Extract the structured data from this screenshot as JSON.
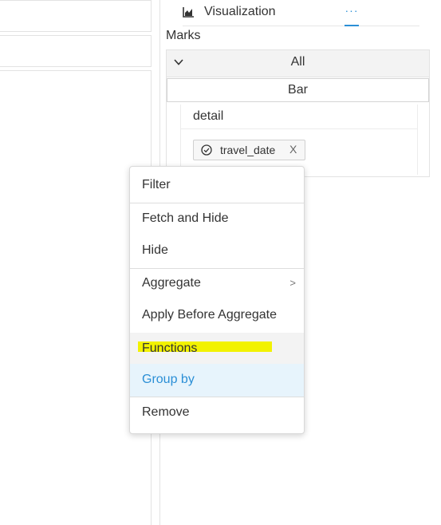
{
  "visualization": {
    "title": "Visualization",
    "more_tab_label": "···",
    "chart_icon": "area-chart-icon"
  },
  "marks": {
    "label": "Marks",
    "all_label": "All",
    "mark_type": "Bar",
    "detail_label": "detail",
    "field_chip": {
      "name": "travel_date",
      "icon": "check-circle-icon",
      "close": "X"
    }
  },
  "context_menu": {
    "items": [
      {
        "label": "Filter"
      },
      {
        "label": "Fetch and Hide"
      },
      {
        "label": "Hide"
      },
      {
        "label": "Aggregate",
        "submenu_indicator": ">"
      },
      {
        "label": "Apply Before Aggregate"
      },
      {
        "label": "Functions"
      },
      {
        "label": "Group by"
      },
      {
        "label": "Remove"
      }
    ],
    "highlight_color": "#f2f200",
    "hover_color": "#e7f4fc",
    "accent_color": "#2b8fd6"
  }
}
